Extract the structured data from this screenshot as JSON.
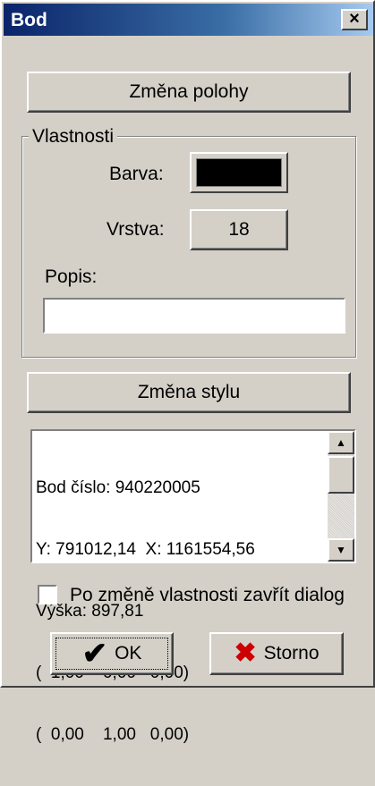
{
  "window": {
    "title": "Bod",
    "close_label": "×"
  },
  "buttons": {
    "change_position": "Změna polohy",
    "change_style": "Změna stylu",
    "ok": "OK",
    "cancel": "Storno"
  },
  "properties": {
    "group_label": "Vlastnosti",
    "color_label": "Barva:",
    "color_value": "#000000",
    "layer_label": "Vrstva:",
    "layer_value": "18",
    "description_label": "Popis:",
    "description_value": ""
  },
  "info_list": {
    "lines": [
      "Bod číslo: 940220005",
      "Y: 791012,14  X: 1161554,56",
      "Výška: 897,81",
      "(  1,00    0,00   0,00)",
      "(  0,00    1,00   0,00)"
    ]
  },
  "options": {
    "close_after_change_label": "Po změně vlastnosti zavřít dialog",
    "close_after_change_checked": false
  }
}
